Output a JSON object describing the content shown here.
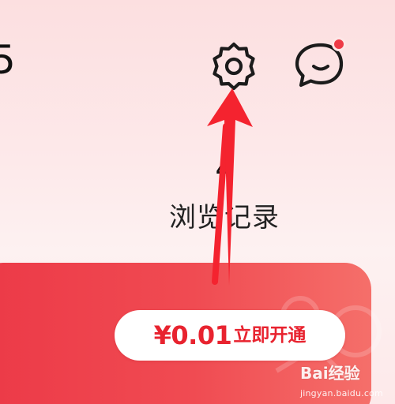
{
  "header": {
    "cut_off_text": "5",
    "settings_icon": "gear-icon",
    "messages_icon": "chat-bubble-icon",
    "messages_unread_badge": true
  },
  "stats": {
    "history_count": "4",
    "history_label": "浏览记录"
  },
  "vip_banner": {
    "price": "¥0.01",
    "cta_label": "立即开通"
  },
  "annotation": {
    "arrow_color": "#f4232f",
    "points_to": "settings"
  },
  "watermark": {
    "logo": "Bai经验",
    "url": "jingyan.baidu.com"
  },
  "colors": {
    "accent": "#e8232f",
    "banner": "#ee3f4b",
    "badge": "#ee3a46",
    "background_top": "#fcdfe0"
  }
}
